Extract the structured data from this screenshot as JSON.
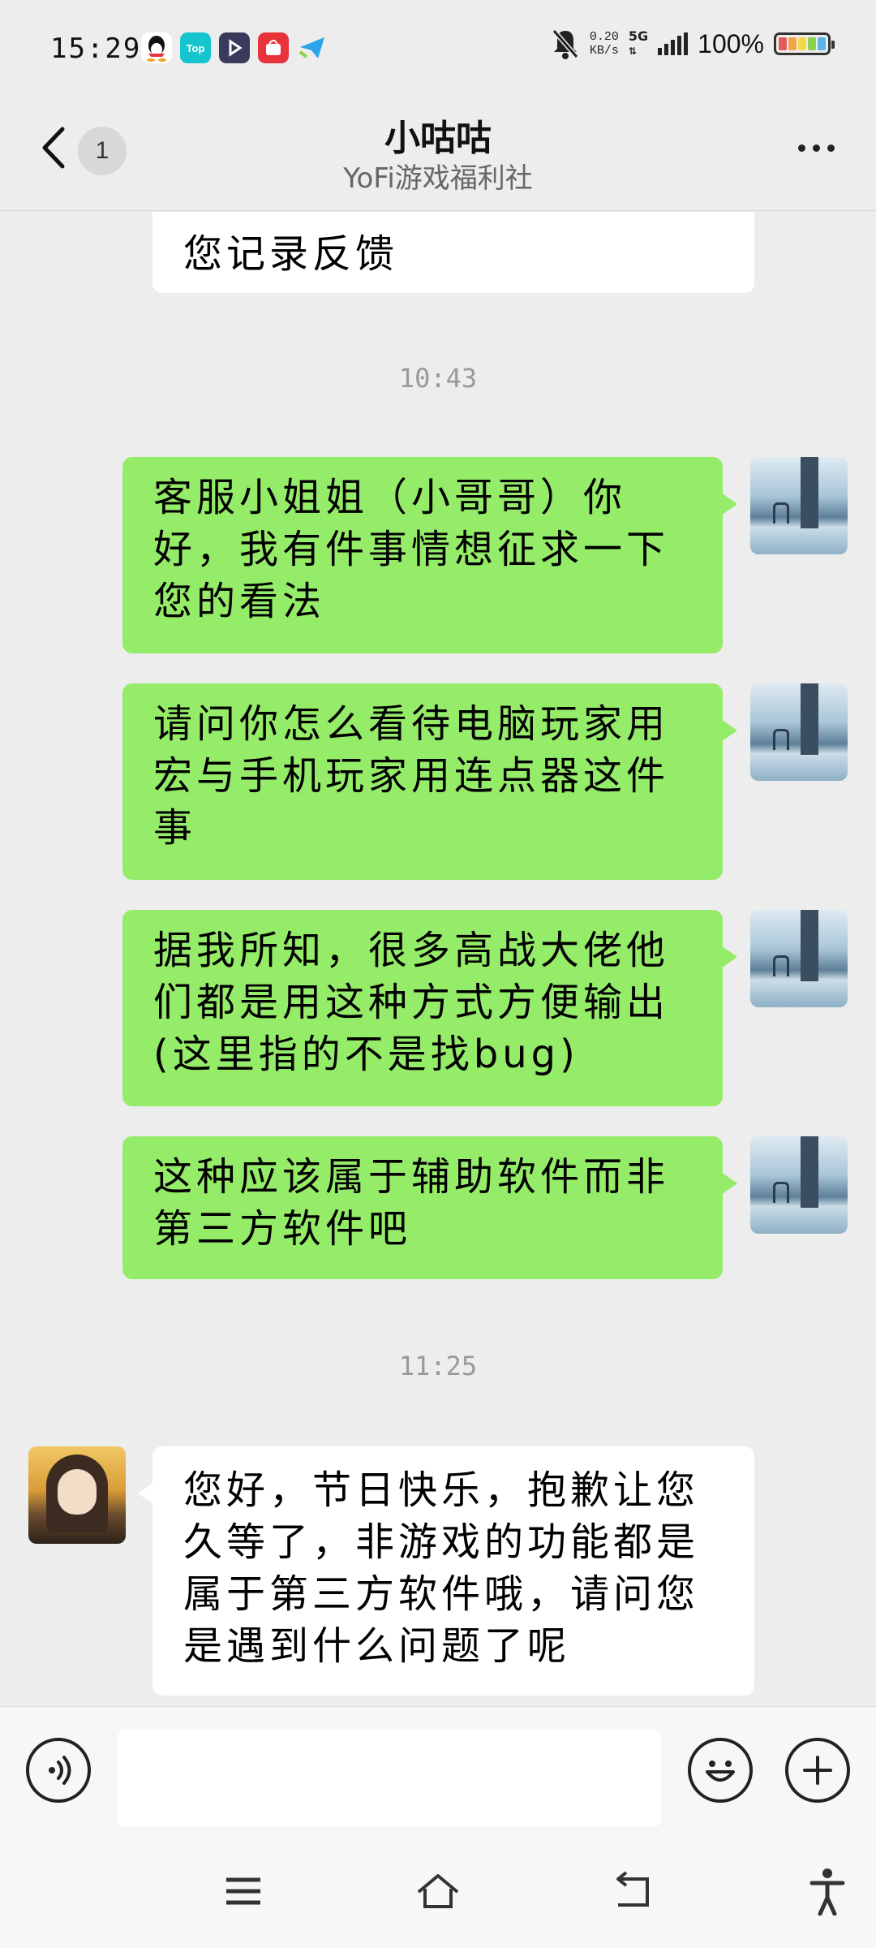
{
  "status_bar": {
    "time": "15:29",
    "apps": [
      {
        "name": "qq-icon",
        "label": "",
        "color": "#ffffff"
      },
      {
        "name": "taptap-icon",
        "label": "Top",
        "color": "#15c5ce"
      },
      {
        "name": "video-app-icon",
        "label": "",
        "color": "#3a3a5c"
      },
      {
        "name": "shopping-app-icon",
        "label": "",
        "color": "#e8333a"
      },
      {
        "name": "paper-plane-icon",
        "label": "",
        "color": "#2aa6e8"
      }
    ],
    "net_speed_value": "0.20",
    "net_speed_unit": "KB/s",
    "network_type": "5G",
    "battery_percent": "100%",
    "battery_level": 1.0
  },
  "header": {
    "unread_count": "1",
    "title": "小咕咕",
    "subtitle": "YoFi游戏福利社"
  },
  "chat": {
    "partial_message": "您记录反馈",
    "timestamp_1": "10:43",
    "outgoing_messages": [
      {
        "lines": [
          "客服小姐姐（小哥哥）你",
          "好，我有件事情想征求一下",
          "您的看法"
        ]
      },
      {
        "lines": [
          "请问你怎么看待电脑玩家用",
          "宏与手机玩家用连点器这件",
          "事"
        ]
      },
      {
        "lines": [
          "据我所知，很多高战大佬他",
          "们都是用这种方式方便输出",
          "(这里指的不是找bug)"
        ]
      },
      {
        "lines": [
          "这种应该属于辅助软件而非",
          "第三方软件吧"
        ]
      }
    ],
    "timestamp_2": "11:25",
    "incoming_message": {
      "lines": [
        "您好，节日快乐，抱歉让您",
        "久等了，非游戏的功能都是",
        "属于第三方软件哦，请问您",
        "是遇到什么问题了呢"
      ]
    }
  },
  "input_bar": {
    "placeholder": ""
  },
  "colors": {
    "outgoing_bubble": "#95ec69",
    "incoming_bubble": "#ffffff",
    "background": "#ededed"
  }
}
